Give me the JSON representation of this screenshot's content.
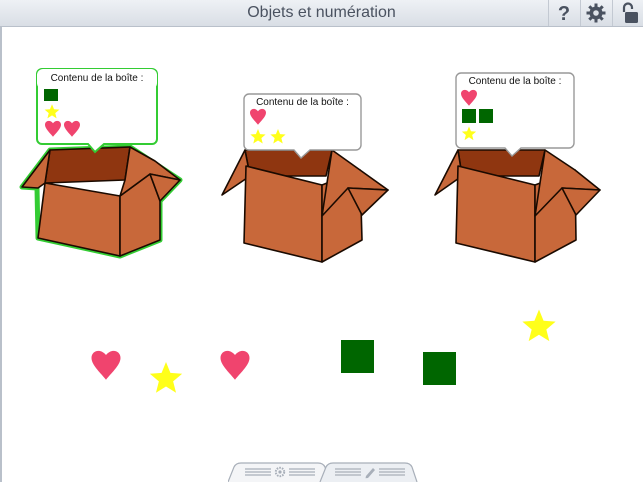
{
  "app": {
    "title": "Objets et numération"
  },
  "toolbar": {
    "help_icon": "question-mark",
    "settings_icon": "gear",
    "lock_icon": "unlocked-padlock"
  },
  "boxes": [
    {
      "label": "Contenu de la boîte :",
      "selected": true,
      "contents": [
        "green-square",
        "yellow-star",
        "pink-heart",
        "pink-heart"
      ]
    },
    {
      "label": "Contenu de la boîte :",
      "selected": false,
      "contents": [
        "pink-heart",
        "yellow-star",
        "yellow-star"
      ]
    },
    {
      "label": "Contenu de la boîte :",
      "selected": false,
      "contents": [
        "pink-heart",
        "green-square",
        "green-square",
        "yellow-star"
      ]
    }
  ],
  "loose_objects": [
    "pink-heart",
    "yellow-star",
    "pink-heart",
    "green-square",
    "green-square",
    "yellow-star"
  ],
  "bottom_tabs": [
    {
      "icon": "gear-icon"
    },
    {
      "icon": "pencil-icon"
    }
  ],
  "colors": {
    "box_front": "#c8683a",
    "box_dark": "#8f3610",
    "box_selected_outline": "#33cc33",
    "heart": "#f0446e",
    "star": "#ffff1a",
    "square": "#006600",
    "toolbar_text": "#4a5260"
  }
}
